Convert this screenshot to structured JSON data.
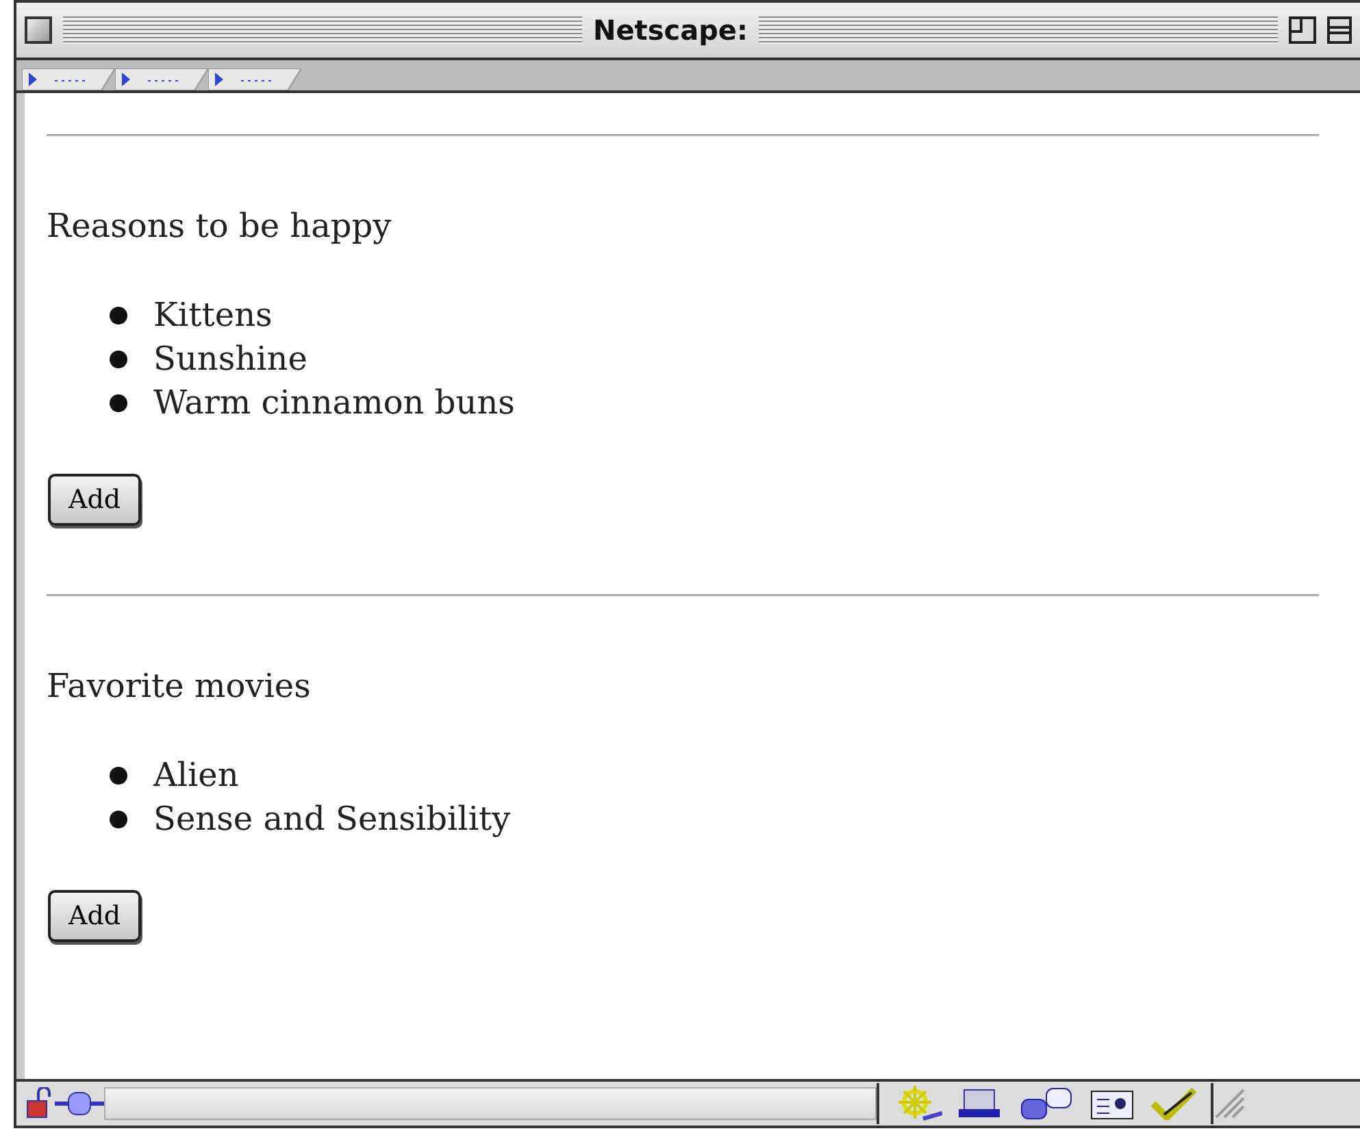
{
  "window": {
    "title": "Netscape:"
  },
  "sections": [
    {
      "heading": "Reasons to be happy",
      "items": [
        "Kittens",
        "Sunshine",
        "Warm cinnamon buns"
      ],
      "button": "Add"
    },
    {
      "heading": "Favorite movies",
      "items": [
        "Alien",
        "Sense and Sensibility"
      ],
      "button": "Add"
    }
  ]
}
